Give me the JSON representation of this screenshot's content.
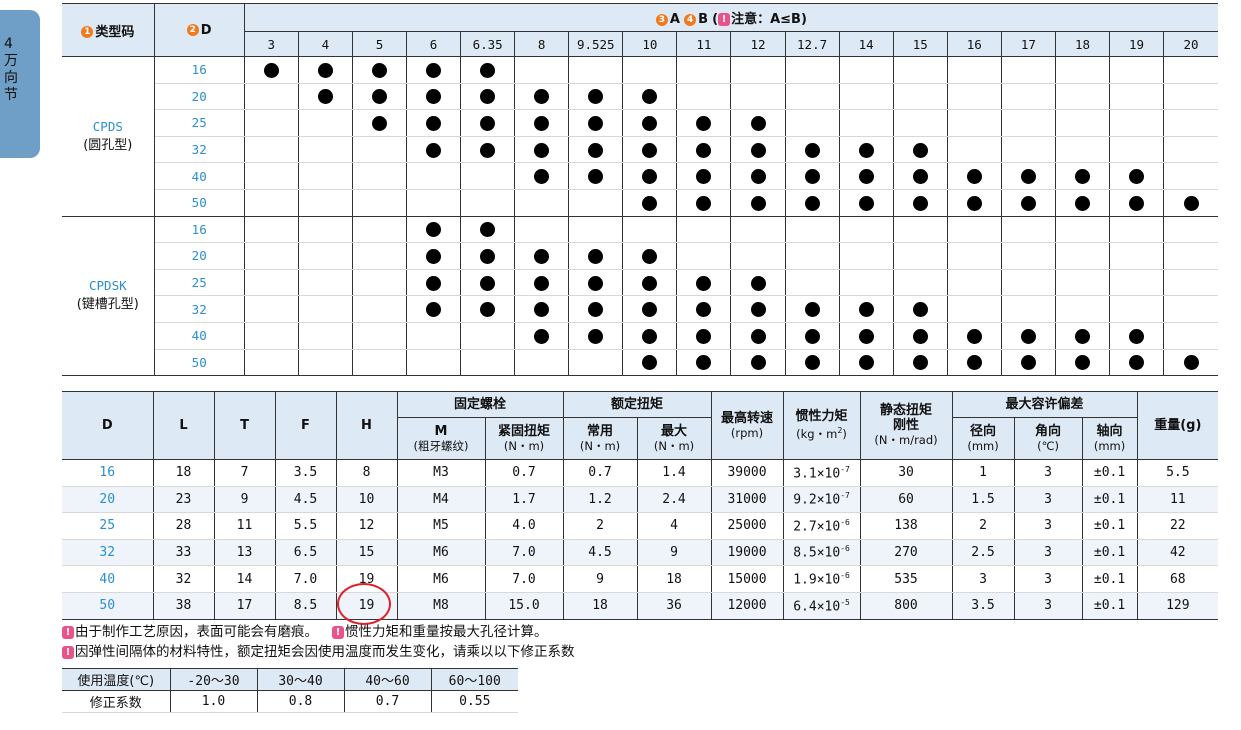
{
  "side_tab": {
    "chars": [
      "4",
      "万",
      "向",
      "节"
    ]
  },
  "compat": {
    "col1": {
      "num": "1",
      "label": "类型码"
    },
    "col2": {
      "num": "2",
      "label": "D"
    },
    "ab_header": {
      "num_a": "3",
      "label_a": "A",
      "num_b": "4",
      "label_b": "B",
      "paren_open": "(",
      "note_label": "注意：A≤B",
      "paren_close": ")"
    },
    "a_values": [
      "3",
      "4",
      "5",
      "6",
      "6.35",
      "8",
      "9.525",
      "10",
      "11",
      "12",
      "12.7",
      "14",
      "15",
      "16",
      "17",
      "18",
      "19",
      "20"
    ],
    "groups": [
      {
        "code": "CPDS",
        "type": "(圆孔型)",
        "rows": [
          {
            "d": "16",
            "dots": [
              1,
              1,
              1,
              1,
              1,
              0,
              0,
              0,
              0,
              0,
              0,
              0,
              0,
              0,
              0,
              0,
              0,
              0
            ]
          },
          {
            "d": "20",
            "dots": [
              0,
              1,
              1,
              1,
              1,
              1,
              1,
              1,
              0,
              0,
              0,
              0,
              0,
              0,
              0,
              0,
              0,
              0
            ]
          },
          {
            "d": "25",
            "dots": [
              0,
              0,
              1,
              1,
              1,
              1,
              1,
              1,
              1,
              1,
              0,
              0,
              0,
              0,
              0,
              0,
              0,
              0
            ]
          },
          {
            "d": "32",
            "dots": [
              0,
              0,
              0,
              1,
              1,
              1,
              1,
              1,
              1,
              1,
              1,
              1,
              1,
              0,
              0,
              0,
              0,
              0
            ]
          },
          {
            "d": "40",
            "dots": [
              0,
              0,
              0,
              0,
              0,
              1,
              1,
              1,
              1,
              1,
              1,
              1,
              1,
              1,
              1,
              1,
              1,
              0
            ]
          },
          {
            "d": "50",
            "dots": [
              0,
              0,
              0,
              0,
              0,
              0,
              0,
              1,
              1,
              1,
              1,
              1,
              1,
              1,
              1,
              1,
              1,
              1
            ]
          }
        ]
      },
      {
        "code": "CPDSK",
        "type": "(键槽孔型)",
        "rows": [
          {
            "d": "16",
            "dots": [
              0,
              0,
              0,
              1,
              1,
              0,
              0,
              0,
              0,
              0,
              0,
              0,
              0,
              0,
              0,
              0,
              0,
              0
            ]
          },
          {
            "d": "20",
            "dots": [
              0,
              0,
              0,
              1,
              1,
              1,
              1,
              1,
              0,
              0,
              0,
              0,
              0,
              0,
              0,
              0,
              0,
              0
            ]
          },
          {
            "d": "25",
            "dots": [
              0,
              0,
              0,
              1,
              1,
              1,
              1,
              1,
              1,
              1,
              0,
              0,
              0,
              0,
              0,
              0,
              0,
              0
            ]
          },
          {
            "d": "32",
            "dots": [
              0,
              0,
              0,
              1,
              1,
              1,
              1,
              1,
              1,
              1,
              1,
              1,
              1,
              0,
              0,
              0,
              0,
              0
            ]
          },
          {
            "d": "40",
            "dots": [
              0,
              0,
              0,
              0,
              0,
              1,
              1,
              1,
              1,
              1,
              1,
              1,
              1,
              1,
              1,
              1,
              1,
              0
            ]
          },
          {
            "d": "50",
            "dots": [
              0,
              0,
              0,
              0,
              0,
              0,
              0,
              1,
              1,
              1,
              1,
              1,
              1,
              1,
              1,
              1,
              1,
              1
            ]
          }
        ]
      }
    ]
  },
  "specs": {
    "headers": {
      "d": "D",
      "l": "L",
      "t": "T",
      "f": "F",
      "h": "H",
      "bolt": "固定螺栓",
      "bolt_m": "M",
      "bolt_m_sub": "(粗牙螺纹)",
      "bolt_torque": "紧固扭矩",
      "bolt_torque_unit": "(N・m)",
      "rated": "额定扭矩",
      "rated_normal": "常用",
      "rated_normal_unit": "(N・m)",
      "rated_max": "最大",
      "rated_max_unit": "(N・m)",
      "speed": "最高转速",
      "speed_unit": "(rpm)",
      "inertia": "惯性力矩",
      "inertia_unit_pre": "(kg・m",
      "inertia_unit_exp": "2",
      "inertia_unit_post": ")",
      "stiff": "静态扭矩",
      "stiff2": "刚性",
      "stiff_unit": "(N・m/rad)",
      "misalign": "最大容许偏差",
      "radial": "径向",
      "radial_unit": "(mm)",
      "angular": "角向",
      "angular_unit": "(℃)",
      "axial": "轴向",
      "axial_unit": "(mm)",
      "weight": "重量(g)"
    },
    "rows": [
      {
        "d": "16",
        "l": "18",
        "t": "7",
        "f": "3.5",
        "h": "8",
        "m": "M3",
        "torque": "0.7",
        "normal": "0.7",
        "max": "1.4",
        "speed": "39000",
        "inertia_m": "3.1×10",
        "inertia_e": "-7",
        "stiff": "30",
        "radial": "1",
        "angular": "3",
        "axial": "±0.1",
        "weight": "5.5"
      },
      {
        "d": "20",
        "l": "23",
        "t": "9",
        "f": "4.5",
        "h": "10",
        "m": "M4",
        "torque": "1.7",
        "normal": "1.2",
        "max": "2.4",
        "speed": "31000",
        "inertia_m": "9.2×10",
        "inertia_e": "-7",
        "stiff": "60",
        "radial": "1.5",
        "angular": "3",
        "axial": "±0.1",
        "weight": "11"
      },
      {
        "d": "25",
        "l": "28",
        "t": "11",
        "f": "5.5",
        "h": "12",
        "m": "M5",
        "torque": "4.0",
        "normal": "2",
        "max": "4",
        "speed": "25000",
        "inertia_m": "2.7×10",
        "inertia_e": "-6",
        "stiff": "138",
        "radial": "2",
        "angular": "3",
        "axial": "±0.1",
        "weight": "22"
      },
      {
        "d": "32",
        "l": "33",
        "t": "13",
        "f": "6.5",
        "h": "15",
        "m": "M6",
        "torque": "7.0",
        "normal": "4.5",
        "max": "9",
        "speed": "19000",
        "inertia_m": "8.5×10",
        "inertia_e": "-6",
        "stiff": "270",
        "radial": "2.5",
        "angular": "3",
        "axial": "±0.1",
        "weight": "42"
      },
      {
        "d": "40",
        "l": "32",
        "t": "14",
        "f": "7.0",
        "h": "19",
        "m": "M6",
        "torque": "7.0",
        "normal": "9",
        "max": "18",
        "speed": "15000",
        "inertia_m": "1.9×10",
        "inertia_e": "-6",
        "stiff": "535",
        "radial": "3",
        "angular": "3",
        "axial": "±0.1",
        "weight": "68"
      },
      {
        "d": "50",
        "l": "38",
        "t": "17",
        "f": "8.5",
        "h": "19",
        "m": "M8",
        "torque": "15.0",
        "normal": "18",
        "max": "36",
        "speed": "12000",
        "inertia_m": "6.4×10",
        "inertia_e": "-5",
        "stiff": "800",
        "radial": "3.5",
        "angular": "3",
        "axial": "±0.1",
        "weight": "129"
      }
    ]
  },
  "notes": {
    "warn_glyph": "!",
    "n1a": "由于制作工艺原因，表面可能会有磨痕。",
    "n1b": "惯性力矩和重量按最大孔径计算。",
    "n2": "因弹性间隔体的材料特性，额定扭矩会因使用温度而发生变化，请乘以以下修正系数"
  },
  "temp_table": {
    "header_label": "使用温度(℃)",
    "ranges": [
      "-20～30",
      "30～40",
      "40～60",
      "60～100"
    ],
    "row_label": "修正系数",
    "factors": [
      "1.0",
      "0.8",
      "0.7",
      "0.55"
    ]
  },
  "colors": {
    "header_bg": "#dde9f4",
    "accent_blue": "#2b8fd0",
    "badge_orange": "#f07a1e",
    "warn_pink": "#e9538a",
    "ring_red": "#e0202a",
    "tab_blue": "#6f9fc6"
  }
}
